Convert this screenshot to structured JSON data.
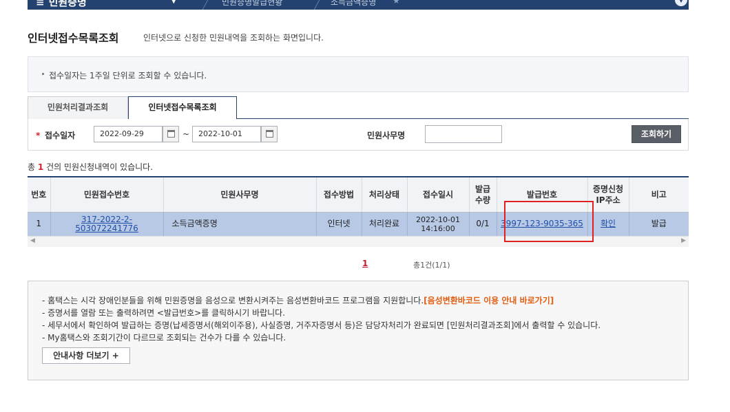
{
  "nav": {
    "menu_title": "민원증명",
    "crumb1": "민원증명발급현황",
    "crumb2": "소득금액증명"
  },
  "page": {
    "title": "인터넷접수목록조회",
    "description": "인터넷으로 신청한 민원내역을 조회하는 화면입니다."
  },
  "notice": {
    "text": "접수일자는 1주일 단위로 조회할 수 있습니다."
  },
  "tabs": [
    {
      "label": "민원처리결과조회",
      "active": false
    },
    {
      "label": "인터넷접수목록조회",
      "active": true
    }
  ],
  "search": {
    "required_mark": "*",
    "date_label": "접수일자",
    "date_from": "2022-09-29",
    "date_sep": "~",
    "date_to": "2022-10-01",
    "office_label": "민원사무명",
    "office_value": "",
    "button_label": "조회하기"
  },
  "summary": {
    "prefix": "총",
    "count": "1",
    "suffix": "건의 민원신청내역이 있습니다."
  },
  "table": {
    "headers": {
      "no": "번호",
      "receipt_no": "민원접수번호",
      "office_name": "민원사무명",
      "method": "접수방법",
      "status": "처리상태",
      "date": "접수일시",
      "qty_1": "발급",
      "qty_2": "수량",
      "issue_no": "발급번호",
      "ip_1": "증명신청",
      "ip_2": "IP주소",
      "remark": "비고"
    },
    "rows": [
      {
        "no": "1",
        "receipt_no": "317-2022-2-503072241776",
        "office_name": "소득금액증명",
        "method": "인터넷",
        "status": "처리완료",
        "date_1": "2022-10-01",
        "date_2": "14:16:00",
        "qty": "0/1",
        "issue_no": "3997-123-9035-365",
        "ip": "확인",
        "remark": "발급"
      }
    ]
  },
  "paging": {
    "current": "1",
    "info": "총1건(1/1)"
  },
  "info": {
    "line1": "- 홈택스는 시각 장애인분들을 위해 민원증명을 음성으로 변환시켜주는 음성변환바코드 프로그램을 지원합니다.",
    "line1_link": "[음성변환바코드 이용 안내 바로가기]",
    "line2": "- 증명서를 열람 또는 출력하려면 <발급번호>를 클릭하시기 바랍니다.",
    "line3": "- 세무서에서 확인하여 발급하는 증명(납세증명서(해외이주용), 사실증명, 거주자증명서 등)은 담당자처리가 완료되면 [민원처리결과조회]에서 출력할 수 있습니다.",
    "line4": "- My홈택스와 조회기간이 다르므로 조회되는 건수가 다를 수 있습니다.",
    "more_button": "안내사항 더보기 +"
  },
  "colors": {
    "nav_bg": "#24426f",
    "row_selected": "#b7c9e5",
    "required": "#d4222a",
    "link": "#1f4fa8",
    "accent_orange": "#e25d10",
    "highlight_box": "#e02020"
  }
}
